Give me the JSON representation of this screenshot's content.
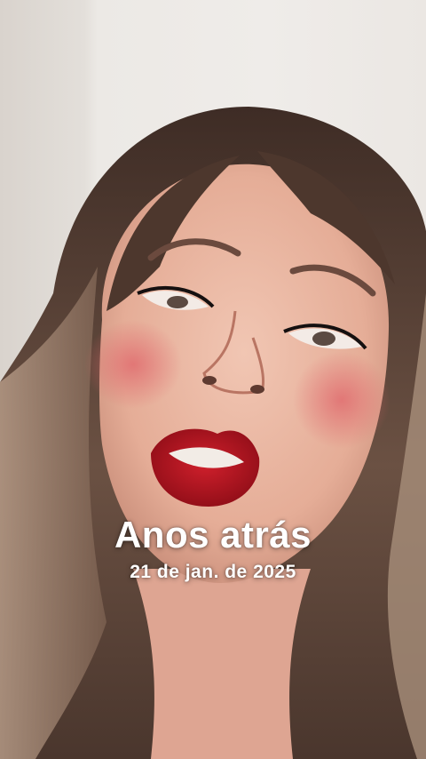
{
  "story": {
    "headline": "Anos atrás",
    "date": "21 de jan. de 2025"
  },
  "colors": {
    "wall": "#ece9e5",
    "hair": "#5a4336",
    "skin": "#e9b7a3",
    "lips": "#b5141f",
    "text": "#ffffff"
  }
}
